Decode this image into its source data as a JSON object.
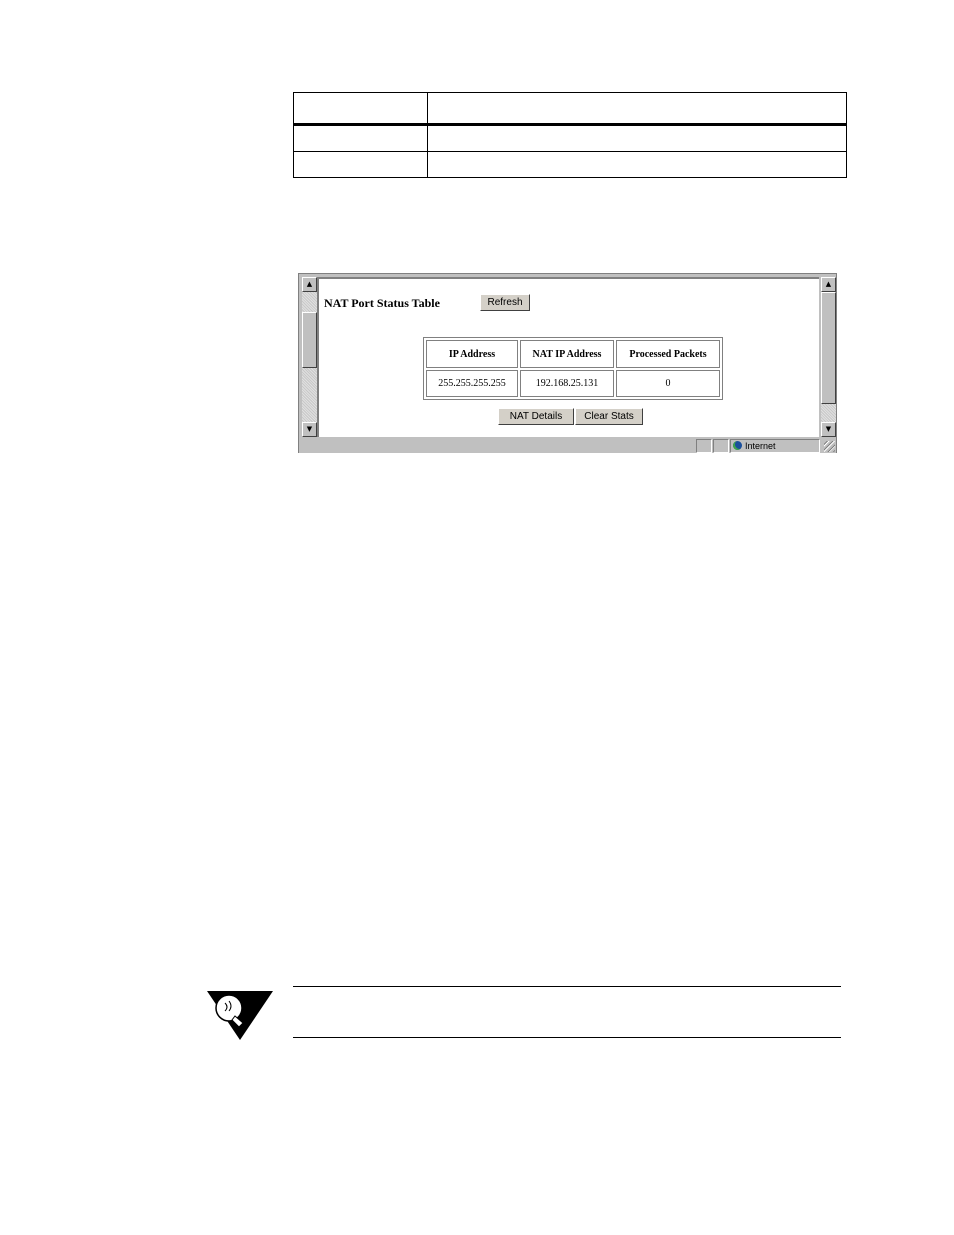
{
  "top_table": {
    "rows": [
      [
        "",
        ""
      ],
      [
        "",
        ""
      ],
      [
        "",
        ""
      ]
    ]
  },
  "screenshot": {
    "page_title": "NAT Port Status Table",
    "refresh_button": "Refresh",
    "table": {
      "headers": [
        "IP Address",
        "NAT IP Address",
        "Processed Packets"
      ],
      "rows": [
        [
          "255.255.255.255",
          "192.168.25.131",
          "0"
        ]
      ]
    },
    "nat_details_button": "NAT Details",
    "clear_stats_button": "Clear Stats",
    "status_zone": "Internet",
    "icons": {
      "scroll_up": "arrow-up-icon",
      "scroll_down": "arrow-down-icon",
      "zone": "globe-icon",
      "resize": "resize-grip-icon"
    }
  },
  "note": {
    "icon": "lightbulb-note-icon",
    "text": ""
  }
}
